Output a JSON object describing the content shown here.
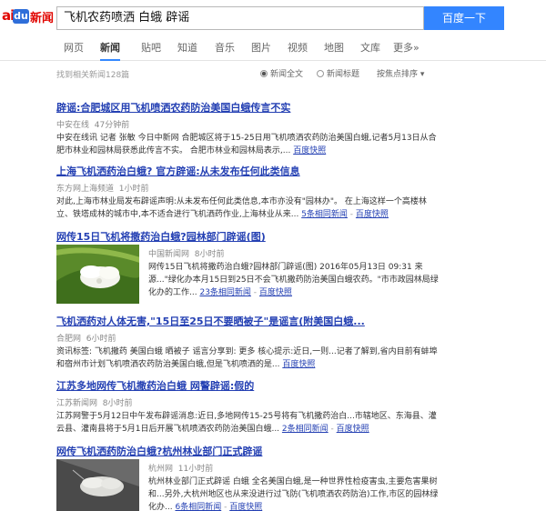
{
  "logo": {
    "paw": "ai",
    "du": "du",
    "word": "新闻"
  },
  "search": {
    "value": "飞机农药喷洒 白蛾 辟谣",
    "button": "百度一下"
  },
  "nav": [
    "网页",
    "新闻",
    "贴吧",
    "知道",
    "音乐",
    "图片",
    "视频",
    "地图",
    "文库",
    "更多»"
  ],
  "toolbar": {
    "count": "找到相关新闻128篇",
    "option_full": "新闻全文",
    "option_title": "新闻标题",
    "sort": "按焦点排序"
  },
  "results": [
    {
      "title": "辟谣:合肥城区用飞机喷洒农药防治美国白蛾传言不实",
      "source": "中安在线",
      "time": "47分钟前",
      "text": "中安在线讯 记者 张敏 今日中新网 合肥城区将于15-25日用飞机喷洒农药防治美国白蛾,记者5月13日从合肥市林业和园林局获悉此传言不实。 合肥市林业和园林局表示,...",
      "cache": "百度快照"
    },
    {
      "title": "上海飞机洒药治白蛾? 官方辟谣:从未发布任何此类信息",
      "source": "东方网上海频道",
      "time": "1小时前",
      "text": "对此,上海市林业局发布辟谣声明:从未发布任何此类信息,本市亦没有\"园林办\"。 在上海这样一个高楼林立、铁塔成林的城市中,本不适合进行飞机洒药作业,上海林业从来...",
      "related": "5条相同新闻",
      "cache": "百度快照"
    },
    {
      "title": "网传15日飞机将撒药治白蛾?园林部门辟谣(图)",
      "source": "中国新闻网",
      "time": "8小时前",
      "text": "网传15日飞机将撒药治白蛾?园林部门辟谣(图) 2016年05月13日 09:31 来源...\"绿化办本月15日到25日不会飞机撒药防治美国白蛾农药。\"市市政园林局绿化办的工作...",
      "related": "23条相同新闻",
      "cache": "百度快照"
    },
    {
      "title": "飞机洒药对人体无害,\"15日至25日不要晒被子\"是谣言(附美国白蛾...",
      "source": "合肥网",
      "time": "6小时前",
      "text": "资讯标签: 飞机撒药 美国白蛾 晒被子 谣言分享到: 更多 核心提示:近日,一则...记者了解到,省内目前有蚌埠和宿州市计划飞机喷洒农药防治美国白蛾,但是飞机喷洒的是...",
      "cache": "百度快照"
    },
    {
      "title": "江苏多地网传飞机撒药治白蛾 网警辟谣:假的",
      "source": "江苏新闻网",
      "time": "8小时前",
      "text": "江苏网警于5月12日中午发布辟谣消息:近日,多地网传15-25号将有飞机撒药治白...市辖地区、东海县、灌云县、灌南县将于5月1日后开展飞机喷洒农药防治美国白蛾...",
      "related": "2条相同新闻",
      "cache": "百度快照"
    },
    {
      "title": "网传飞机洒药防治白蛾?杭州林业部门正式辟谣",
      "source": "杭州网",
      "time": "11小时前",
      "text": "杭州林业部门正式辟谣 白蛾 全名美国白蛾,是一种世界性检疫害虫,主要危害果树和...另外,大杭州地区也从来没进行过飞防(飞机喷洒农药防治)工作,市区的园林绿化办...",
      "related": "6条相同新闻",
      "cache": "百度快照"
    }
  ],
  "colors": {
    "link": "#2440b3",
    "highlight": "#cc0000",
    "brand_red": "#e10601",
    "button": "#3385ff",
    "tab_underline": "#3388ff"
  }
}
